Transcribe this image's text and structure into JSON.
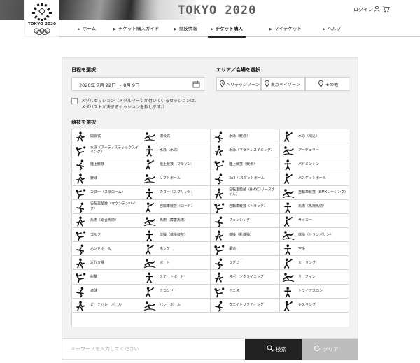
{
  "header": {
    "logo_text": "TOKYO 2020",
    "title": "TOKYO 2020",
    "login_label": "ログイン",
    "icons": [
      "user-icon",
      "cart-icon"
    ]
  },
  "nav": {
    "items": [
      {
        "label": "ホーム",
        "active": false
      },
      {
        "label": "チケット購入ガイド",
        "active": false
      },
      {
        "label": "競技情報",
        "active": false
      },
      {
        "label": "チケット購入",
        "active": true
      },
      {
        "label": "マイチケット",
        "active": false
      },
      {
        "label": "ヘルプ",
        "active": false
      }
    ]
  },
  "filters": {
    "date_heading": "日程を選択",
    "date_range": "2020年 7月 22日 ～ 8月 9日",
    "area_heading": "エリア／会場を選択",
    "areas": [
      "ヘリテッジゾーン",
      "東京ベイゾーン",
      "その他"
    ],
    "medal_label": "メダルセッション（メダルマークが付いているセッションは、",
    "medal_label_2": "メダリストが決まるセッションを指します。）",
    "sports_heading": "競技を選択"
  },
  "sports": [
    "開会式",
    "閉会式",
    "水泳（競泳）",
    "水泳（飛込）",
    "水泳（アーティスティックスイミング）",
    "水泳（水球）",
    "水泳（マラソンスイミング）",
    "アーチェリー",
    "陸上競技",
    "陸上競技（マラソン）",
    "陸上競技（競歩）",
    "バドミントン",
    "野球",
    "ソフトボール",
    "3x3 バスケットボール",
    "バスケットボール",
    "カヌー（スラローム）",
    "カヌー（スプリント）",
    "自転車競技（BMXフリースタイル）",
    "自転車競技（BMXレーシング）",
    "自転車競技（マウンテンバイク）",
    "自転車競技（ロード）",
    "自転車競技（トラック）",
    "馬術（馬場馬術）",
    "馬術（総合馬術）",
    "馬術（障害馬術）",
    "フェンシング",
    "サッカー",
    "ゴルフ",
    "体操（体操競技）",
    "体操（新体操）",
    "体操（トランポリン）",
    "ハンドボール",
    "ホッケー",
    "柔道",
    "空手",
    "近代五種",
    "ボート",
    "ラグビー",
    "セーリング",
    "射撃",
    "スケートボード",
    "スポーツクライミング",
    "サーフィン",
    "卓球",
    "テコンドー",
    "テニス",
    "トライアスロン",
    "ビーチバレーボール",
    "バレーボール",
    "ウエイトリフティング",
    "レスリング"
  ],
  "bottom": {
    "keyword_placeholder": "キーワードを入力してください",
    "search_label": "検索",
    "clear_label": "クリア"
  },
  "colors": {
    "search_button": "#222222",
    "clear_button": "#bcbcbc",
    "panel_bg": "#f2f2f2"
  }
}
